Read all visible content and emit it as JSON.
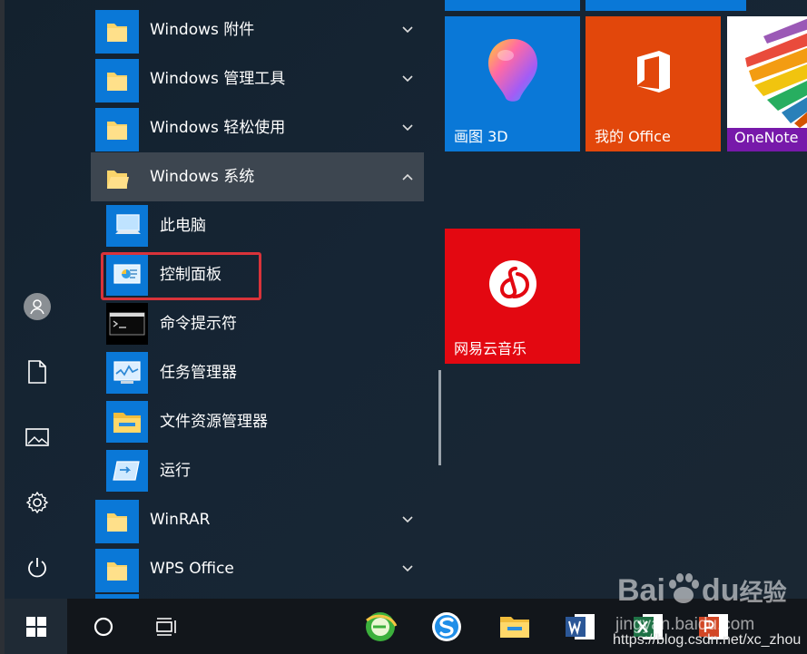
{
  "app_list": {
    "folders_top": [
      {
        "label": "Windows 附件"
      },
      {
        "label": "Windows 管理工具"
      },
      {
        "label": "Windows 轻松使用"
      }
    ],
    "open_folder": {
      "label": "Windows 系统"
    },
    "system_items": [
      {
        "label": "此电脑",
        "icon": "computer-icon"
      },
      {
        "label": "控制面板",
        "icon": "control-panel-icon"
      },
      {
        "label": "命令提示符",
        "icon": "cmd-icon"
      },
      {
        "label": "任务管理器",
        "icon": "task-manager-icon"
      },
      {
        "label": "文件资源管理器",
        "icon": "file-explorer-icon"
      },
      {
        "label": "运行",
        "icon": "run-icon"
      }
    ],
    "folders_bottom": [
      {
        "label": "WinRAR"
      },
      {
        "label": "WPS Office"
      }
    ]
  },
  "tiles": [
    {
      "label": "画图 3D",
      "color": "#0a78d7",
      "icon": "paint3d-icon"
    },
    {
      "label": "我的 Office",
      "color": "#e2470b",
      "icon": "office-icon"
    },
    {
      "label": "OneNote",
      "color": "#7719aa",
      "icon": "onenote-icon"
    },
    {
      "label": "网易云音乐",
      "color": "#e30811",
      "icon": "netease-music-icon"
    }
  ],
  "rail": [
    "user-icon",
    "document-icon",
    "pictures-icon",
    "settings-icon",
    "power-icon"
  ],
  "taskbar": [
    "windows-start-icon",
    "search-circle-icon",
    "task-view-icon",
    "browser-icon",
    "sogou-icon",
    "file-explorer-icon",
    "word-icon",
    "excel-icon",
    "powerpoint-icon"
  ],
  "watermark": {
    "brand": "Bai",
    "brand2": "du",
    "brand3": "经验",
    "site": "jingyan.baidu.com",
    "url": "https://blog.csdn.net/xc_zhou"
  },
  "colors": {
    "accent": "#0a78d7",
    "highlight_border": "#d9333a"
  }
}
